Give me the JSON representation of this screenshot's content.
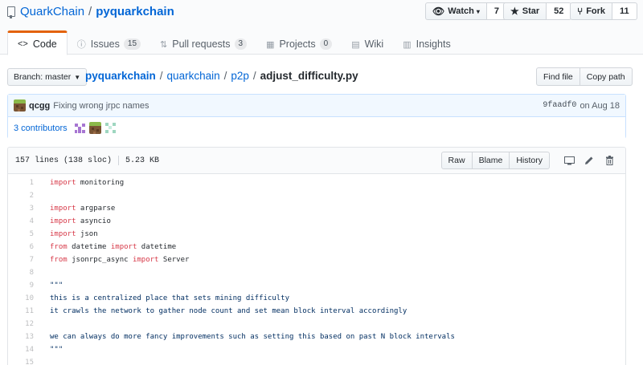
{
  "repo": {
    "owner": "QuarkChain",
    "separator": "/",
    "name": "pyquarkchain"
  },
  "social": {
    "watch": {
      "label": "Watch",
      "count": "7"
    },
    "star": {
      "label": "Star",
      "count": "52"
    },
    "fork": {
      "label": "Fork",
      "count": "11"
    }
  },
  "tabs": [
    {
      "label": "Code",
      "counter": ""
    },
    {
      "label": "Issues",
      "counter": "15"
    },
    {
      "label": "Pull requests",
      "counter": "3"
    },
    {
      "label": "Projects",
      "counter": "0"
    },
    {
      "label": "Wiki",
      "counter": ""
    },
    {
      "label": "Insights",
      "counter": ""
    }
  ],
  "branch": {
    "label": "Branch: master"
  },
  "breadcrumb": {
    "root": "pyquarkchain",
    "p1": "quarkchain",
    "p2": "p2p",
    "file": "adjust_difficulty.py",
    "sep": "/"
  },
  "path_buttons": {
    "find": "Find file",
    "copy": "Copy path"
  },
  "commit": {
    "author": "qcgg",
    "message": "Fixing wrong jrpc names",
    "sha": "9faadf0",
    "date": "on Aug 18"
  },
  "contributors": {
    "label": "3 contributors"
  },
  "file": {
    "lines": "157 lines (138 sloc)",
    "size": "5.23 KB",
    "buttons": {
      "raw": "Raw",
      "blame": "Blame",
      "history": "History"
    }
  },
  "code_lines": [
    {
      "n": "1",
      "parts": [
        [
          "kw",
          "import"
        ],
        [
          "",
          "monitoring"
        ]
      ]
    },
    {
      "n": "2",
      "parts": []
    },
    {
      "n": "3",
      "parts": [
        [
          "kw",
          "import"
        ],
        [
          "",
          "argparse"
        ]
      ]
    },
    {
      "n": "4",
      "parts": [
        [
          "kw",
          "import"
        ],
        [
          "",
          "asyncio"
        ]
      ]
    },
    {
      "n": "5",
      "parts": [
        [
          "kw",
          "import"
        ],
        [
          "",
          "json"
        ]
      ]
    },
    {
      "n": "6",
      "parts": [
        [
          "kw",
          "from"
        ],
        [
          "",
          " datetime "
        ],
        [
          "kw",
          "import"
        ],
        [
          "",
          " datetime"
        ]
      ]
    },
    {
      "n": "7",
      "parts": [
        [
          "kw",
          "from"
        ],
        [
          "",
          " jsonrpc_async "
        ],
        [
          "kw",
          "import"
        ],
        [
          "",
          " Server"
        ]
      ]
    },
    {
      "n": "8",
      "parts": []
    },
    {
      "n": "9",
      "parts": [
        [
          "str",
          "\"\"\""
        ]
      ]
    },
    {
      "n": "10",
      "parts": [
        [
          "str",
          "this is a centralized place that sets mining difficulty"
        ]
      ]
    },
    {
      "n": "11",
      "parts": [
        [
          "str",
          "it crawls the network to gather node count and set mean block interval accordingly"
        ]
      ]
    },
    {
      "n": "12",
      "parts": []
    },
    {
      "n": "13",
      "parts": [
        [
          "str",
          "we can always do more fancy improvements such as setting this based on past N block intervals"
        ]
      ]
    },
    {
      "n": "14",
      "parts": [
        [
          "str",
          "\"\"\""
        ]
      ]
    },
    {
      "n": "15",
      "parts": []
    }
  ],
  "colors": {
    "link": "#0366d6",
    "tab_accent": "#e36209",
    "keyword": "#d73a49",
    "string": "#032f62"
  },
  "icons": {
    "repo": "repo-icon",
    "watch": "eye-icon",
    "star": "star-icon",
    "fork": "fork-icon"
  }
}
